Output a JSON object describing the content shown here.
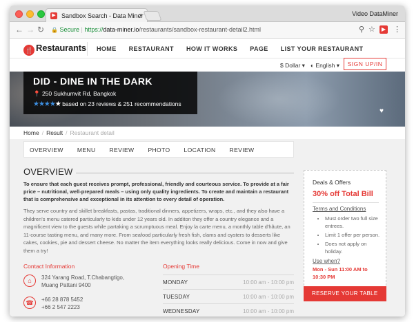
{
  "browser": {
    "tab_title": "Sandbox Search - Data Miner",
    "tab_close": "×",
    "profile_name": "Video DataMiner",
    "secure_label": "Secure",
    "url_scheme": "https://",
    "url_host": "data-miner.io",
    "url_path": "/restaurants/sandbox-restaurant-detail2.html",
    "back_glyph": "←",
    "forward_glyph": "→",
    "reload_glyph": "↻",
    "lock_glyph": "🔒",
    "search_glyph": "⚲",
    "star_glyph": "☆",
    "menu_glyph": "⋮"
  },
  "site": {
    "logo_mark": "🍴",
    "logo_text": "Restaurants",
    "nav": [
      "HOME",
      "RESTAURANT",
      "HOW IT WORKS",
      "PAGE",
      "LIST YOUR RESTAURANT"
    ],
    "currency": "$ Dollar ▾",
    "language": "◐ English ▾",
    "signup": "SIGN UP/IN"
  },
  "restaurant": {
    "name": "DID - DINE IN THE DARK",
    "address": "📍 250 Sukhumvit Rd, Bangkok",
    "stars_filled": "★★★★",
    "stars_empty": "★",
    "rating_text": "based on 23 reviews & 251 recommendations",
    "rating_stars": 4,
    "heart": "♥"
  },
  "breadcrumb": {
    "home": "Home",
    "result": "Result",
    "current": "Restaurant detail",
    "sep": "/"
  },
  "tabs": [
    "OVERVIEW",
    "MENU",
    "REVIEW",
    "PHOTO",
    "LOCATION",
    "REVIEW"
  ],
  "overview": {
    "title": "OVERVIEW",
    "lead": "To ensure that each guest receives prompt, professional, friendly and courteous service. To provide at a fair price – nutritional, well-prepared meals – using only quality ingredients. To create and maintain a restaurant that is comprehensive and exceptional in its attention to every detail of operation.",
    "body": "They serve country and skillet breakfasts, pastas, traditional dinners, appetizers, wraps, etc., and they also have a children's menu catered particularly to kids under 12 years old. In additon they offer a country elegance and a magnificent view to the guests while partaking a scrumptuous meal. Enjoy la carte menu, a monthly table d'hâute, an 11-course tasting menu, and many more. From seafood particularly fresh fish, clams and oysters to desserts like cakes, cookies, pie and dessert cheese. No matter the item everything looks really delicious. Come in now and give them a try!"
  },
  "contact": {
    "title": "Contact Information",
    "address_icon": "⌂",
    "address_lines": [
      "324 Yarang Road, T.Chabangtigo,",
      "Muang Pattani 9400"
    ],
    "phone_icon": "☎",
    "phone_lines": [
      "+66 28 878 5452",
      "+66 2 547 2223"
    ]
  },
  "hours": {
    "title": "Opening Time",
    "rows": [
      {
        "day": "MONDAY",
        "time": "10:00 am - 10:00 pm"
      },
      {
        "day": "TUESDAY",
        "time": "10:00 am - 10:00 pm"
      },
      {
        "day": "WEDNESDAY",
        "time": "10:00 am - 10:00 pm"
      }
    ]
  },
  "deals": {
    "title": "Deals & Offers",
    "headline": "30% off Total Bill",
    "terms_label": "Terms and Conditions",
    "terms": [
      "Must order two full size entrees.",
      "Limit 1 offer per person.",
      "Does not apply on holiday."
    ],
    "use_when_label": "Use when?",
    "use_when": "Mon - Sun 11:00 AM to 10:30 PM"
  },
  "reserve": {
    "label": "RESERVE YOUR TABLE"
  },
  "colors": {
    "accent": "#e53935",
    "star": "#3c8dde"
  }
}
